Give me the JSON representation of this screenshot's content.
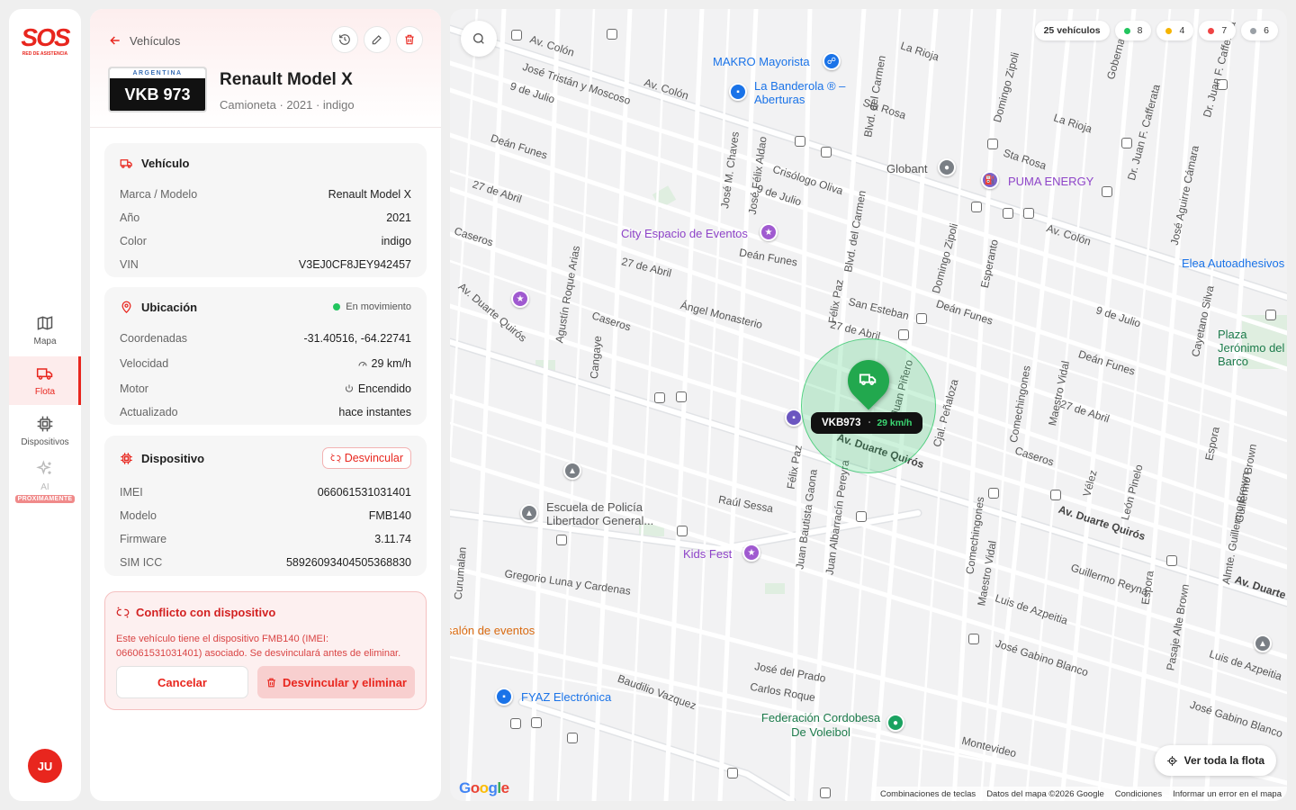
{
  "brand": {
    "name": "SOS",
    "tagline": "RED DE ASISTENCIA"
  },
  "nav": [
    {
      "label": "Mapa",
      "icon": "map-icon",
      "active": false
    },
    {
      "label": "Flota",
      "icon": "truck-icon",
      "active": true
    },
    {
      "label": "Dispositivos",
      "icon": "chip-icon",
      "active": false
    },
    {
      "label": "AI",
      "icon": "sparkles-icon",
      "active": false,
      "badge": "PRÓXIMAMENTE"
    }
  ],
  "user": {
    "initials": "JU"
  },
  "panel": {
    "back_label": "Vehículos",
    "plate": {
      "country": "ARGENTINA",
      "number": "VKB 973"
    },
    "title": "Renault Model X",
    "subtitle": "Camioneta · 2021 · indigo",
    "vehicle": {
      "title": "Vehículo",
      "rows": [
        {
          "k": "Marca / Modelo",
          "v": "Renault Model X"
        },
        {
          "k": "Año",
          "v": "2021"
        },
        {
          "k": "Color",
          "v": "indigo"
        },
        {
          "k": "VIN",
          "v": "V3EJ0CF8JEY942457"
        }
      ]
    },
    "location": {
      "title": "Ubicación",
      "status": "En movimiento",
      "rows": [
        {
          "k": "Coordenadas",
          "v": "-31.40516, -64.22741"
        },
        {
          "k": "Velocidad",
          "v": "29 km/h"
        },
        {
          "k": "Motor",
          "v": "Encendido"
        },
        {
          "k": "Actualizado",
          "v": "hace instantes"
        }
      ]
    },
    "device": {
      "title": "Dispositivo",
      "unlink_label": "Desvincular",
      "rows": [
        {
          "k": "IMEI",
          "v": "066061531031401"
        },
        {
          "k": "Modelo",
          "v": "FMB140"
        },
        {
          "k": "Firmware",
          "v": "3.11.74"
        },
        {
          "k": "SIM ICC",
          "v": "58926093404505368830"
        }
      ]
    },
    "conflict": {
      "title": "Conflicto con dispositivo",
      "text": "Este vehículo tiene el dispositivo FMB140 (IMEI: 066061531031401) asociado. Se desvinculará antes de eliminar.",
      "cancel_label": "Cancelar",
      "confirm_label": "Desvincular y eliminar"
    }
  },
  "map": {
    "counts": {
      "total": "25 vehículos",
      "green": "8",
      "yellow": "4",
      "red": "7",
      "gray": "6"
    },
    "status_colors": {
      "green": "#22c55e",
      "yellow": "#f5b400",
      "red": "#ef4444",
      "gray": "#9aa0a6"
    },
    "vehicle_tag": {
      "plate": "VKB973",
      "speed": "29 km/h"
    },
    "fleet_button": "Ver toda la flota",
    "streets": [
      "Av. Colón",
      "Av. Colón",
      "Av. Colón",
      "José Tristán y Moscoso",
      "9 de Julio",
      "Deán Funes",
      "27 de Abril",
      "Caseros",
      "27 de Abril",
      "Crisólogo Oliva",
      "9 de Julio",
      "Deán Funes",
      "Av. Duarte Quirós",
      "Agustín Roque Arias",
      "Cangaye",
      "Caseros",
      "Ángel Monasterio",
      "San Esteban",
      "27 de Abril",
      "Deán Funes",
      "9 de Julio",
      "Deán Funes",
      "27 de Abril",
      "Caseros",
      "Av. Duarte Quirós",
      "Av. Duarte Quirós",
      "Av. Duarte Quirós",
      "Raúl Sessa",
      "Gregorio Luna y Cardenas",
      "Baudilio Vazquez",
      "José del Prado",
      "Carlos Roque",
      "Guillermo Reyna",
      "Luis de Azpeitia",
      "José Gabino Blanco",
      "Montevideo",
      "Luis de Azpeitia",
      "José Gabino Blanco",
      "Sta Rosa",
      "Sta Rosa",
      "La Rioja",
      "La Rioja",
      "Blvd. del Carmen",
      "José M. Chaves",
      "José Félix Aldao",
      "Blvd. del Carmen",
      "Félix Paz",
      "Félix Paz",
      "Juan Piñero",
      "Cjal. Peñaloza",
      "Domingo Zipoli",
      "Domingo Zipoli",
      "Esperanto",
      "Comechingones",
      "Comechingones",
      "Maestro Vidal",
      "Maestro Vidal",
      "Vélez",
      "León Pinelo",
      "Cayetano Silva",
      "Espora",
      "Espora",
      "José Aguirre Cámara",
      "Guillermo Brown",
      "Pasaje Alte Brown",
      "Almte. Guillermo Brown",
      "Juan Bautista Gaona",
      "Juan Albarracín Pereyra",
      "Curumalan",
      "Gobernador",
      "Dr. Juan F. Cafferata",
      "Dr. Juan F. Cafferata"
    ],
    "pois": [
      {
        "name": "MAKRO Mayorista",
        "type": "shopping"
      },
      {
        "name": "La Banderola ® – Aberturas",
        "type": "shopping"
      },
      {
        "name": "Globant",
        "type": "generic"
      },
      {
        "name": "PUMA ENERGY",
        "type": "fuel"
      },
      {
        "name": "City Espacio de Eventos",
        "type": "venue"
      },
      {
        "name": "Elea Autoadhesivos",
        "type": "shopping"
      },
      {
        "name": "Plaza Jerónimo del Barco",
        "type": "park"
      },
      {
        "name": "Escuela de Policía Libertador General...",
        "type": "school"
      },
      {
        "name": "Kids Fest",
        "type": "venue"
      },
      {
        "name": "salón de eventos",
        "type": "venue"
      },
      {
        "name": "FYAZ Electrónica",
        "type": "shopping"
      },
      {
        "name": "Federación Cordobesa De Voleibol",
        "type": "sport"
      }
    ],
    "footer": [
      "Combinaciones de teclas",
      "Datos del mapa ©2026 Google",
      "Condiciones",
      "Informar un error en el mapa"
    ],
    "google_logo": "Google"
  }
}
